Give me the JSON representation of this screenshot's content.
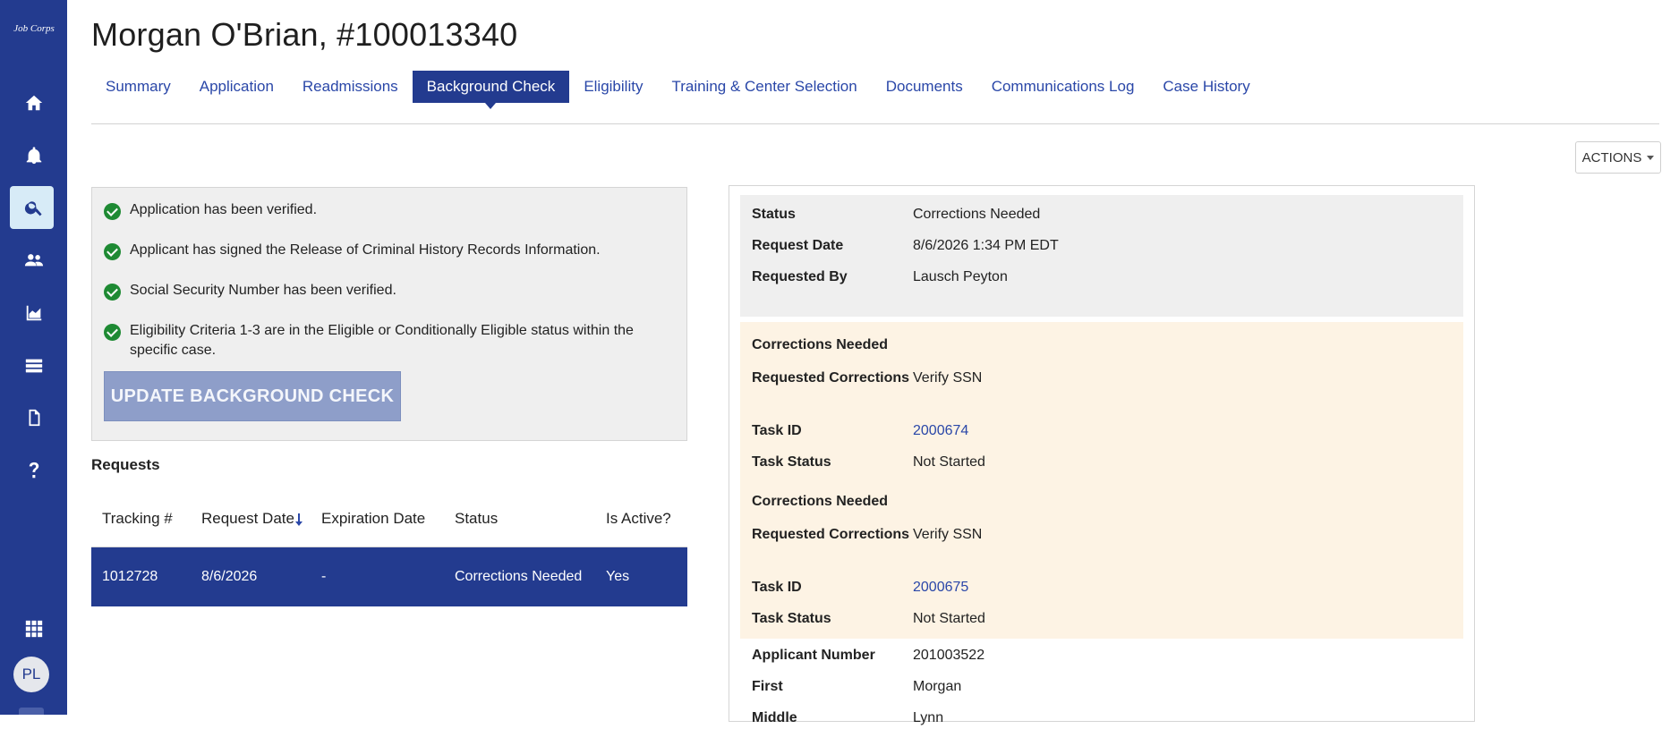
{
  "sidebar": {
    "logo": "Job Corps",
    "avatar_initials": "PL",
    "items": [
      {
        "name": "home-icon",
        "active": false
      },
      {
        "name": "bell-icon",
        "active": false
      },
      {
        "name": "search-icon",
        "active": true
      },
      {
        "name": "people-icon",
        "active": false
      },
      {
        "name": "chart-icon",
        "active": false
      },
      {
        "name": "list-icon",
        "active": false
      },
      {
        "name": "document-icon",
        "active": false
      },
      {
        "name": "help-icon",
        "active": false
      },
      {
        "name": "apps-grid-icon",
        "active": false
      }
    ]
  },
  "header": {
    "title": "Morgan O'Brian, #100013340",
    "tabs": [
      {
        "label": "Summary"
      },
      {
        "label": "Application"
      },
      {
        "label": "Readmissions"
      },
      {
        "label": "Background Check"
      },
      {
        "label": "Eligibility"
      },
      {
        "label": "Training & Center Selection"
      },
      {
        "label": "Documents"
      },
      {
        "label": "Communications Log"
      },
      {
        "label": "Case History"
      }
    ],
    "active_tab": "Background Check",
    "actions_label": "ACTIONS"
  },
  "checklist": {
    "items": [
      "Application has been verified.",
      "Applicant has signed the Release of Criminal History Records Information.",
      "Social Security Number has been verified.",
      "Eligibility Criteria 1-3 are in the Eligible or Conditionally Eligible status within the specific case."
    ],
    "update_button": "UPDATE BACKGROUND CHECK"
  },
  "requests": {
    "title": "Requests",
    "columns": [
      "Tracking #",
      "Request Date",
      "Expiration Date",
      "Status",
      "Is Active?"
    ],
    "rows": [
      {
        "tracking": "1012728",
        "request_date": "8/6/2026",
        "expiration_date": "-",
        "status": "Corrections Needed",
        "is_active": "Yes"
      }
    ]
  },
  "detail": {
    "summary": [
      {
        "key": "Status",
        "value": "Corrections Needed"
      },
      {
        "key": "Request Date",
        "value": "8/6/2026 1:34 PM EDT"
      },
      {
        "key": "Requested By",
        "value": "Lausch Peyton"
      }
    ],
    "corrections": [
      {
        "title": "Corrections Needed",
        "requested_label": "Requested Corrections",
        "requested": "Verify SSN",
        "task_id_label": "Task ID",
        "task_id": "2000674",
        "task_status_label": "Task Status",
        "task_status": "Not Started"
      },
      {
        "title": "Corrections Needed",
        "requested_label": "Requested Corrections",
        "requested": "Verify SSN",
        "task_id_label": "Task ID",
        "task_id": "2000675",
        "task_status_label": "Task Status",
        "task_status": "Not Started"
      }
    ],
    "applicant": [
      {
        "key": "Applicant Number",
        "value": "201003522"
      },
      {
        "key": "First",
        "value": "Morgan"
      },
      {
        "key": "Middle",
        "value": "Lynn"
      }
    ]
  },
  "colors": {
    "brand": "#233b8f",
    "success": "#1e8a33",
    "link": "#2a47a8",
    "peach_panel": "#fdf3e4"
  }
}
